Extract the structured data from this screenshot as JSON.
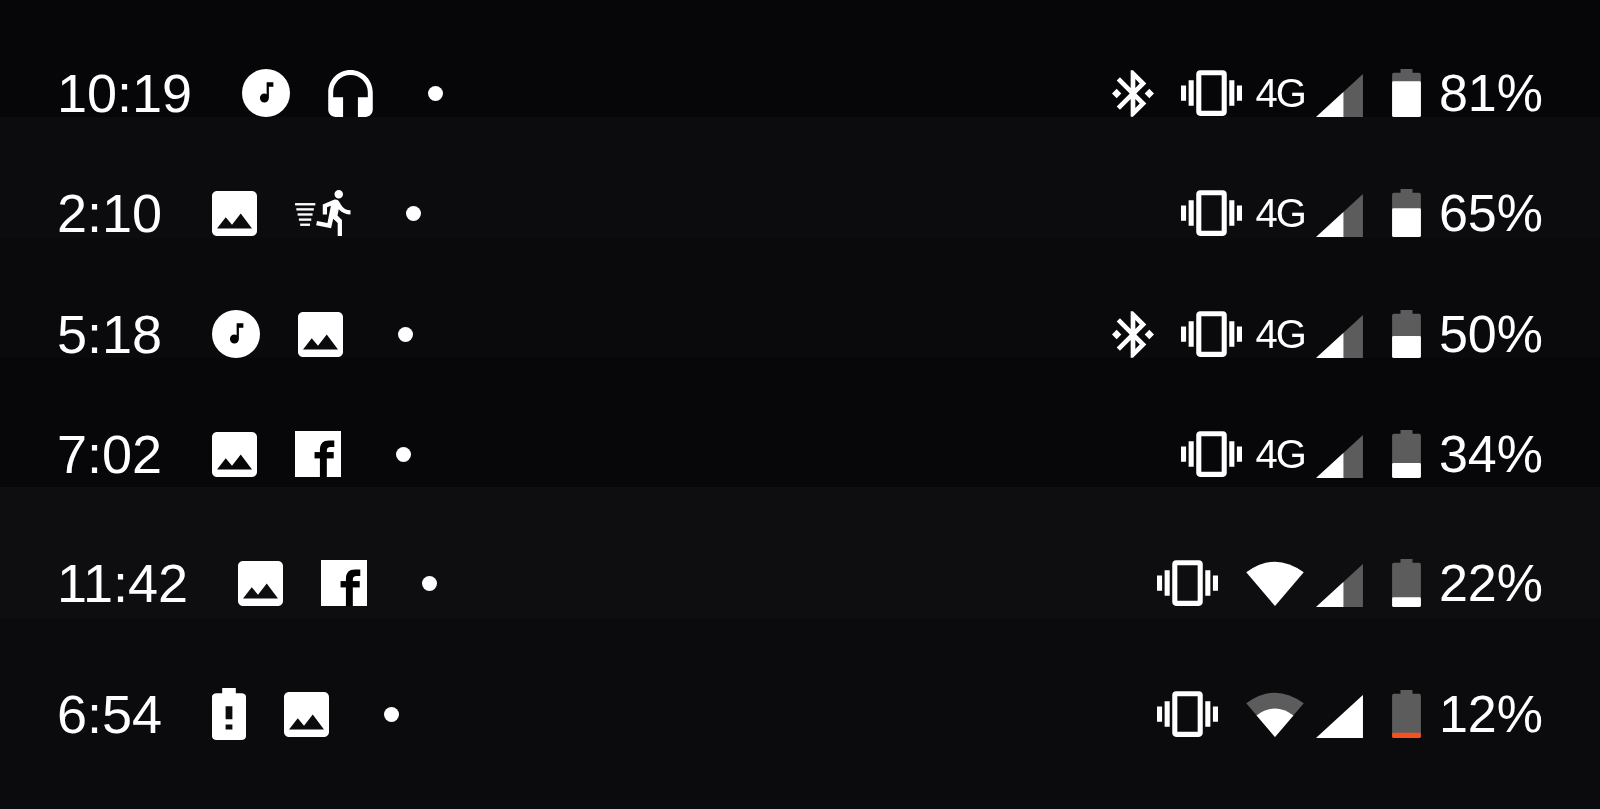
{
  "status_bars": [
    {
      "time": "10:19",
      "notifications": [
        {
          "kind": "music"
        },
        {
          "kind": "headphones"
        }
      ],
      "more_notifications": true,
      "bluetooth": true,
      "vibrate": true,
      "network": {
        "kind": "mobile",
        "label": "4G"
      },
      "signal": {
        "full": false
      },
      "battery": {
        "reading": "81%"
      }
    },
    {
      "time": "2:10",
      "notifications": [
        {
          "kind": "image"
        },
        {
          "kind": "runner"
        }
      ],
      "more_notifications": true,
      "bluetooth": false,
      "vibrate": true,
      "network": {
        "kind": "mobile",
        "label": "4G"
      },
      "signal": {
        "full": false
      },
      "battery": {
        "reading": "65%"
      }
    },
    {
      "time": "5:18",
      "notifications": [
        {
          "kind": "music"
        },
        {
          "kind": "image"
        }
      ],
      "more_notifications": true,
      "bluetooth": true,
      "vibrate": true,
      "network": {
        "kind": "mobile",
        "label": "4G"
      },
      "signal": {
        "full": false
      },
      "battery": {
        "reading": "50%"
      }
    },
    {
      "time": "7:02",
      "notifications": [
        {
          "kind": "image"
        },
        {
          "kind": "f_square"
        }
      ],
      "more_notifications": true,
      "bluetooth": false,
      "vibrate": true,
      "network": {
        "kind": "mobile",
        "label": "4G"
      },
      "signal": {
        "full": false
      },
      "battery": {
        "reading": "34%"
      }
    },
    {
      "time": "11:42",
      "notifications": [
        {
          "kind": "image"
        },
        {
          "kind": "f_square"
        }
      ],
      "more_notifications": true,
      "bluetooth": false,
      "vibrate": true,
      "network": {
        "kind": "wifi",
        "full": true
      },
      "signal": {
        "full": false
      },
      "battery": {
        "reading": "22%"
      }
    },
    {
      "time": "6:54",
      "notifications": [
        {
          "kind": "battery_alert"
        },
        {
          "kind": "image"
        }
      ],
      "more_notifications": true,
      "bluetooth": false,
      "vibrate": true,
      "network": {
        "kind": "wifi",
        "full": false
      },
      "signal": {
        "full": true
      },
      "battery": {
        "reading": "12%"
      }
    }
  ]
}
